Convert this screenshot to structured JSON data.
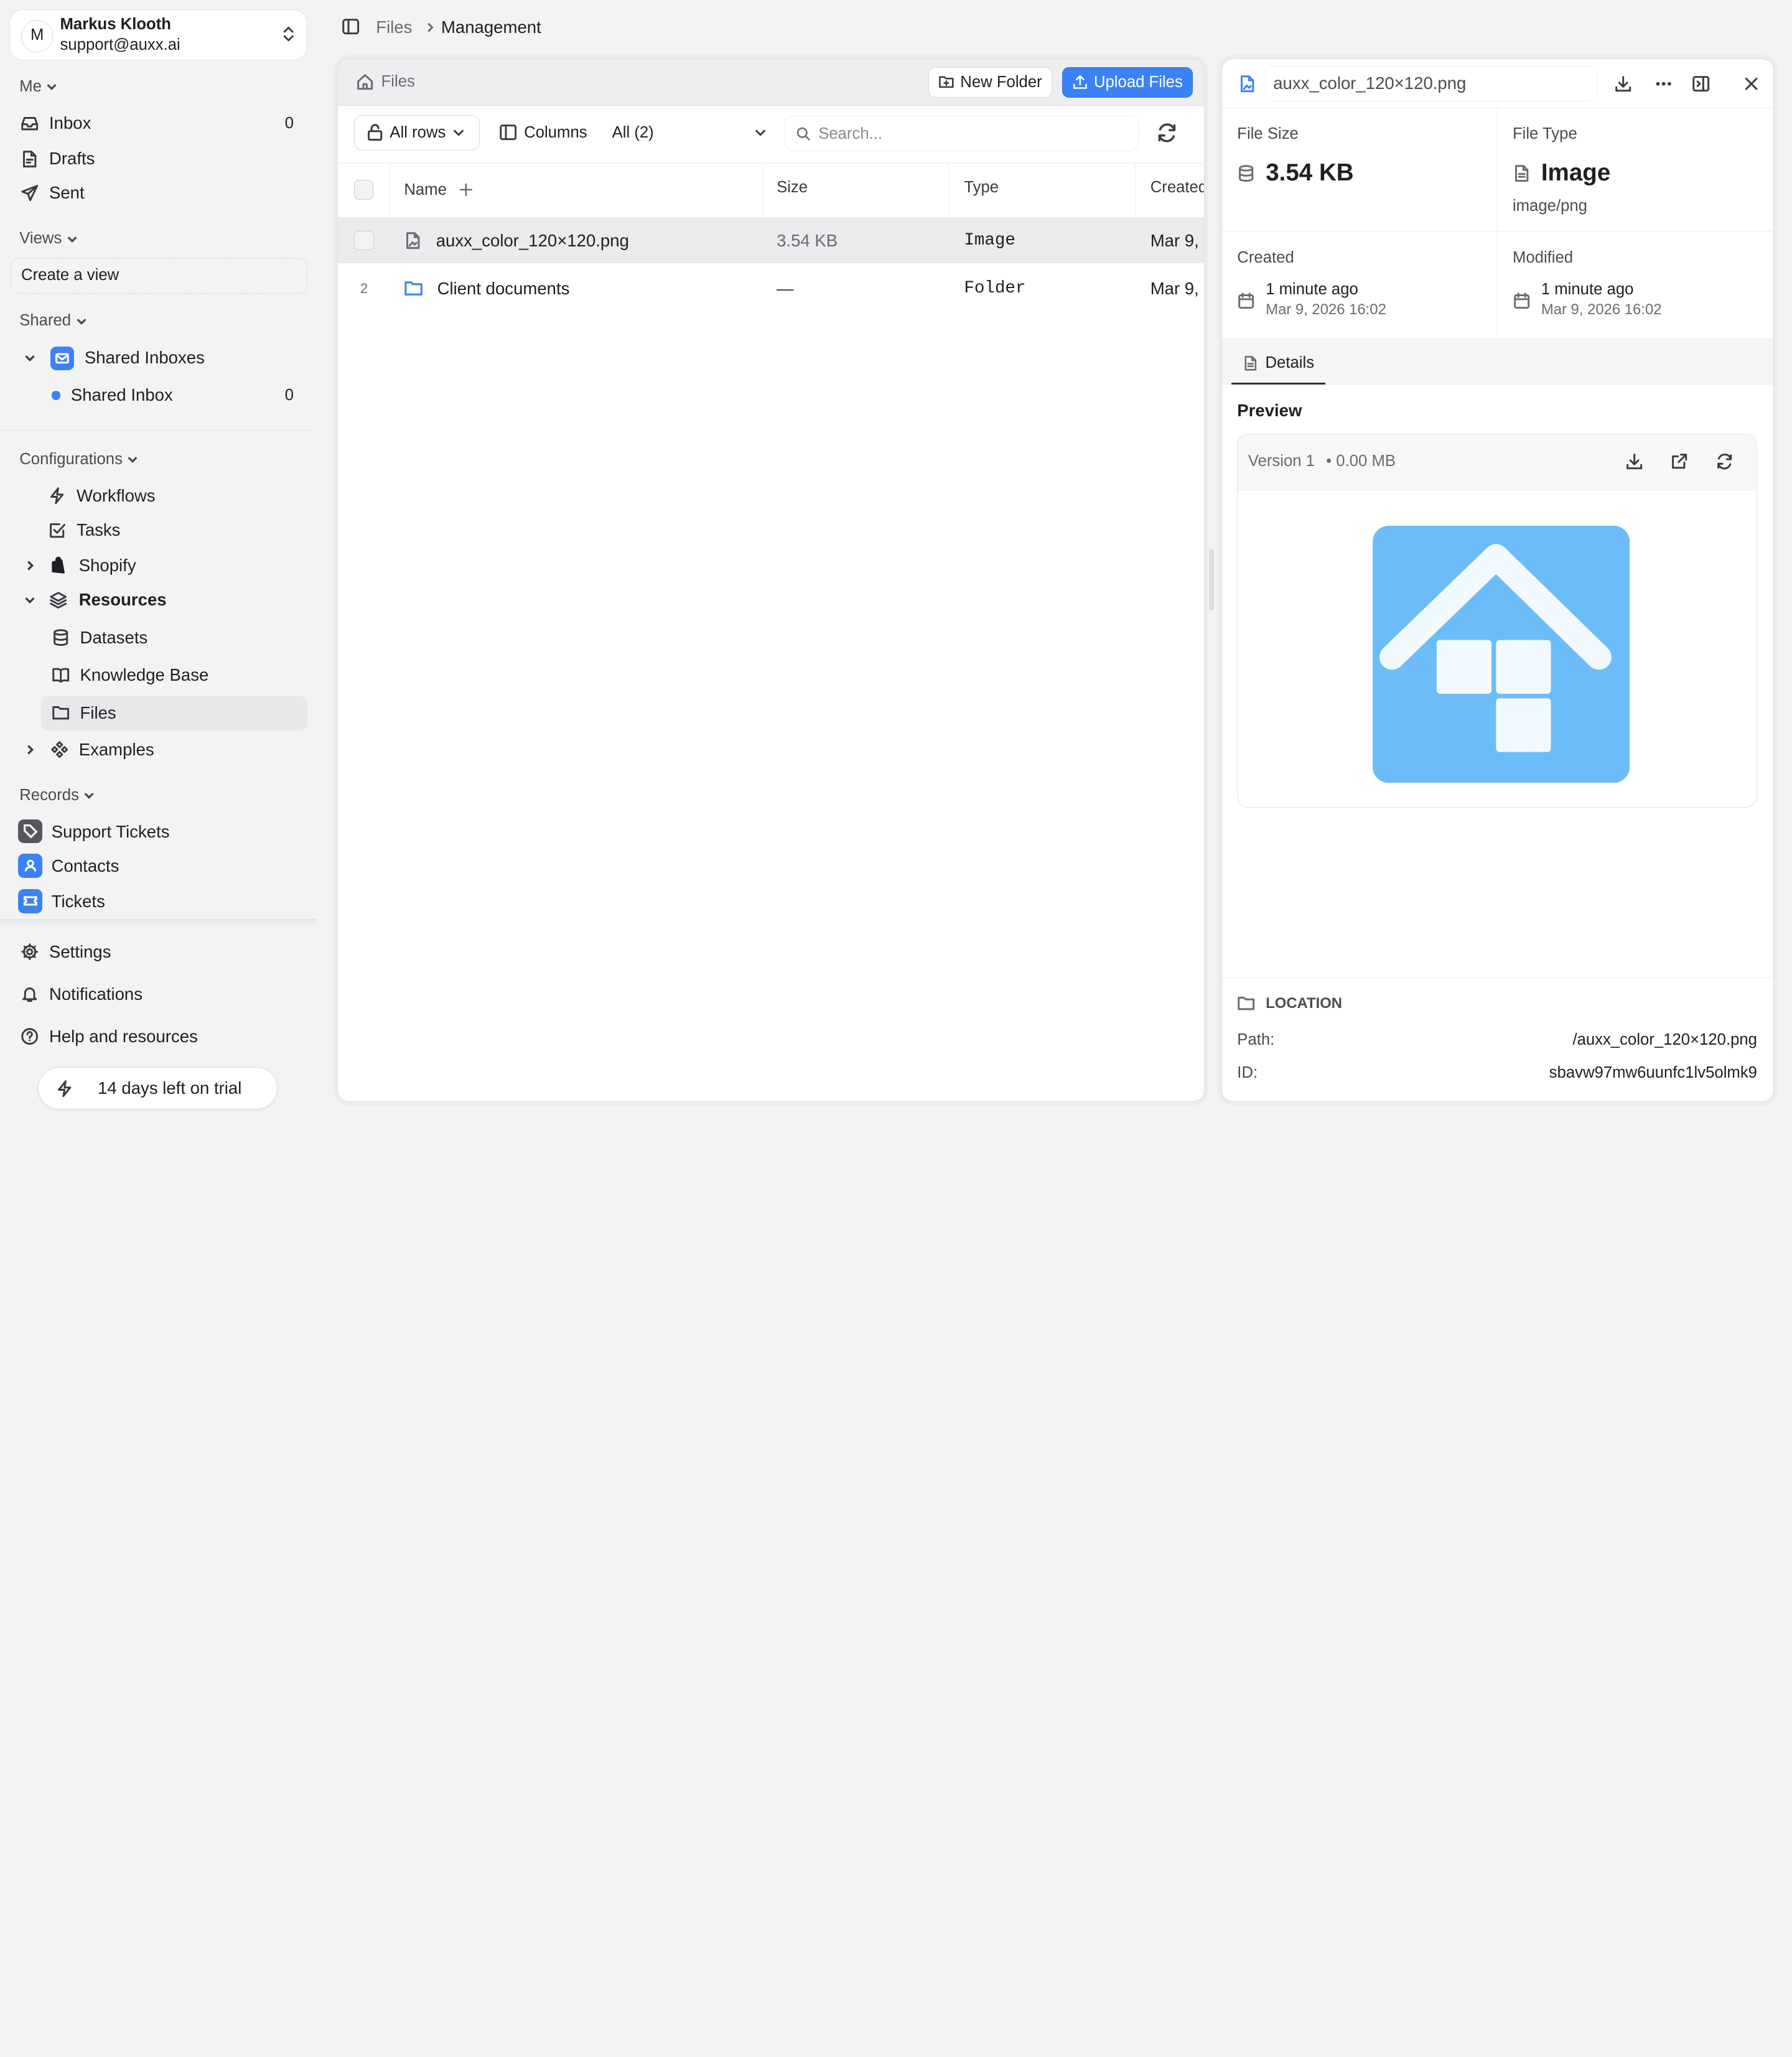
{
  "account": {
    "initial": "M",
    "name": "Markus Klooth",
    "email": "support@auxx.ai"
  },
  "sidebar": {
    "me_label": "Me",
    "me_items": [
      {
        "label": "Inbox",
        "count": "0",
        "icon": "inbox-icon"
      },
      {
        "label": "Drafts",
        "icon": "drafts-icon"
      },
      {
        "label": "Sent",
        "icon": "send-icon"
      }
    ],
    "views_label": "Views",
    "create_view": "Create a view",
    "shared_label": "Shared",
    "shared_inboxes": "Shared Inboxes",
    "shared_inbox": {
      "label": "Shared Inbox",
      "count": "0"
    },
    "config_label": "Configurations",
    "config_items": [
      "Workflows",
      "Tasks",
      "Shopify",
      "Resources",
      "Datasets",
      "Knowledge Base",
      "Files",
      "Examples"
    ],
    "records_label": "Records",
    "records": [
      "Support Tickets",
      "Contacts",
      "Tickets"
    ],
    "bottom": [
      "Settings",
      "Notifications",
      "Help and resources"
    ],
    "trial": "14 days left on trial"
  },
  "breadcrumb": {
    "parent": "Files",
    "current": "Management"
  },
  "files": {
    "title": "Files",
    "new_folder": "New Folder",
    "upload": "Upload Files",
    "all_rows": "All rows",
    "columns": "Columns",
    "view_select": "All (2)",
    "search_placeholder": "Search...",
    "headers": {
      "name": "Name",
      "size": "Size",
      "type": "Type",
      "created": "Created"
    },
    "rows": [
      {
        "index": "",
        "name": "auxx_color_120×120.png",
        "size": "3.54 KB",
        "type": "Image",
        "created": "Mar 9,"
      },
      {
        "index": "2",
        "name": "Client documents",
        "size": "—",
        "type": "Folder",
        "created": "Mar 9,"
      }
    ]
  },
  "detail": {
    "filename": "auxx_color_120×120.png",
    "file_size_label": "File Size",
    "file_size": "3.54 KB",
    "file_type_label": "File Type",
    "file_type": "Image",
    "mime": "image/png",
    "created_label": "Created",
    "created_rel": "1 minute ago",
    "created_abs": "Mar 9, 2026 16:02",
    "modified_label": "Modified",
    "modified_rel": "1 minute ago",
    "modified_abs": "Mar 9, 2026 16:02",
    "tab": "Details",
    "preview_label": "Preview",
    "version": "Version 1",
    "version_size": "• 0.00 MB",
    "location_label": "LOCATION",
    "path_label": "Path:",
    "path": "/auxx_color_120×120.png",
    "id_label": "ID:",
    "id": "sbavw97mw6uunfc1lv5olmk9"
  },
  "colors": {
    "accent": "#3b82f6",
    "preview_bg": "#6cbdf7",
    "active_bg": "#e8e8eb"
  }
}
